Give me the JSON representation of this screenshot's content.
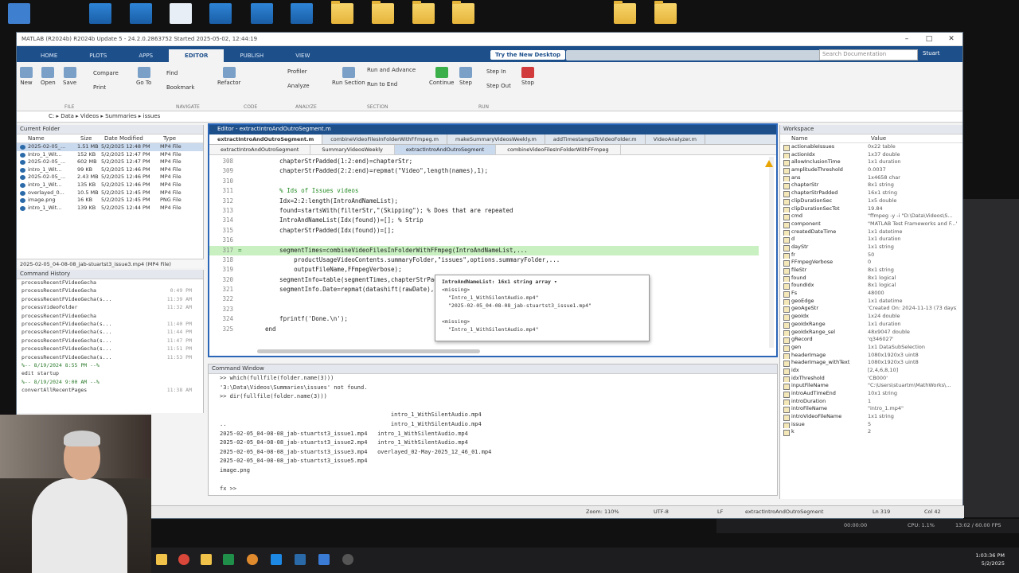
{
  "window": {
    "title": "MATLAB (R2024b) R2024b Update 5 - 24.2.0.2863752 Started 2025-05-02, 12:44:19"
  },
  "ribbon_tabs": [
    "HOME",
    "PLOTS",
    "APPS",
    "EDITOR",
    "PUBLISH",
    "VIEW"
  ],
  "active_tab": "EDITOR",
  "try_new_desktop": "Try the New Desktop",
  "search_placeholder": "Search Documentation",
  "user_name": "Stuart",
  "ribbon": {
    "buttons": [
      "New",
      "Open",
      "Save",
      "Compare",
      "Print",
      "Go To",
      "Find",
      "Bookmark",
      "Refactor",
      "Profiler",
      "Analyze",
      "Run Section",
      "Run and Advance",
      "Run to End",
      "Continue",
      "Step",
      "Step In",
      "Step Out",
      "Stop"
    ],
    "sections": [
      "FILE",
      "NAVIGATE",
      "CODE",
      "ANALYZE",
      "SECTION",
      "RUN"
    ]
  },
  "address_path": "C:  ▸  Data  ▸  Videos  ▸  Summaries  ▸  issues",
  "current_folder": {
    "title": "Current Folder",
    "columns": [
      "Name",
      "Size",
      "Date Modified",
      "Type"
    ],
    "files": [
      {
        "name": "2025-02-05_...",
        "size": "1.51 MB",
        "date": "5/2/2025 12:48 PM",
        "type": "MP4 File"
      },
      {
        "name": "Intro_1_Wit...",
        "size": "152 KB",
        "date": "5/2/2025 12:47 PM",
        "type": "MP4 File"
      },
      {
        "name": "2025-02-05_...",
        "size": "602 MB",
        "date": "5/2/2025 12:47 PM",
        "type": "MP4 File"
      },
      {
        "name": "intro_1_Wit...",
        "size": "99 KB",
        "date": "5/2/2025 12:46 PM",
        "type": "MP4 File"
      },
      {
        "name": "2025-02-05_...",
        "size": "2.43 MB",
        "date": "5/2/2025 12:46 PM",
        "type": "MP4 File"
      },
      {
        "name": "intro_1_Wit...",
        "size": "135 KB",
        "date": "5/2/2025 12:46 PM",
        "type": "MP4 File"
      },
      {
        "name": "overlayed_0...",
        "size": "10.5 MB",
        "date": "5/2/2025 12:45 PM",
        "type": "MP4 File"
      },
      {
        "name": "image.png",
        "size": "16 KB",
        "date": "5/2/2025 12:45 PM",
        "type": "PNG File"
      },
      {
        "name": "intro_1_Wit...",
        "size": "139 KB",
        "date": "5/2/2025 12:44 PM",
        "type": "MP4 File"
      }
    ],
    "detail": "2025-02-05_04-08-08_jab-stuartst3_issue3.mp4 (MP4 File)"
  },
  "command_history": {
    "title": "Command History",
    "rows": [
      {
        "text": "processRecentFVideoGecha",
        "time": ""
      },
      {
        "text": "processRecentFVideoGecha",
        "time": "0:49 PM"
      },
      {
        "text": "processRecentFVideoGecha(s...",
        "time": "11:39 AM"
      },
      {
        "text": "processVideoFolder",
        "time": "11:32 AM"
      },
      {
        "text": "processRecentFVideoGecha",
        "time": ""
      },
      {
        "text": "processRecentFVideoGecha(s...",
        "time": "11:40 PM"
      },
      {
        "text": "processRecentFVideoGecha(s...",
        "time": "11:44 PM"
      },
      {
        "text": "processRecentFVideoGecha(s...",
        "time": "11:47 PM"
      },
      {
        "text": "processRecentFVideoGecha(s...",
        "time": "11:51 PM"
      },
      {
        "text": "processRecentFVideoGecha(s...",
        "time": "11:53 PM"
      },
      {
        "text": "%-- 8/19/2024 8:55 PM --%",
        "time": "",
        "sep": true
      },
      {
        "text": "edit startup",
        "time": ""
      },
      {
        "text": "%-- 8/19/2024 9:00 AM --%",
        "time": "",
        "sep": true
      },
      {
        "text": "convertAllRecentPages",
        "time": "11:38 AM"
      }
    ]
  },
  "editor": {
    "title": "Editor - extractIntroAndOutroSegment.m",
    "file_tabs": [
      "extractIntroAndOutroSegment.m",
      "combineVideoFilesInFolderWithFFmpeg.m",
      "makeSummaryVideosWeekly.m",
      "addTimestampsToVideoFolder.m",
      "VideoAnalyzer.m"
    ],
    "func_tabs": [
      "extractIntroAndOutroSegment",
      "SummaryVideosWeekly",
      "extractIntroAndOutroSegment",
      "combineVideoFilesInFolderWithFFmpeg"
    ],
    "active_func_tab": 2,
    "lines": [
      {
        "n": "308",
        "text": "    chapterStrPadded(1:2:end)=chapterStr;"
      },
      {
        "n": "309",
        "text": "    chapterStrPadded(2:2:end)=repmat(\"Video\",length(names),1);"
      },
      {
        "n": "310",
        "text": ""
      },
      {
        "n": "311",
        "text": "    % Ids of Issues videos"
      },
      {
        "n": "312",
        "text": "    Idx=2:2:length(IntroAndNameList);"
      },
      {
        "n": "313",
        "text": "    found=startsWith(filterStr,\"(Skipping\"); % Does that are repeated"
      },
      {
        "n": "314",
        "text": "    IntroAndNameList(Idx(found))=[]; % Strip"
      },
      {
        "n": "315",
        "text": "    chapterStrPadded(Idx(found))=[];"
      },
      {
        "n": "316",
        "text": ""
      },
      {
        "n": "317",
        "text": "    segmentTimes=combineVideoFilesInFolderWithFFmpeg(IntroAndNameList,...",
        "hl": true,
        "marker": "="
      },
      {
        "n": "318",
        "text": "        productUsageVideoContents.summaryFolder,\"issues\",options.summaryFolder,..."
      },
      {
        "n": "319",
        "text": "        outputFileName,FFmpegVerbose);"
      },
      {
        "n": "320",
        "text": "    segmentInfo=table(segmentTimes,chapterStrPadded,..."
      },
      {
        "n": "321",
        "text": "    segmentInfo.Date=repmat(datashift(rawDate),..."
      },
      {
        "n": "322",
        "text": ""
      },
      {
        "n": "323",
        "text": ""
      },
      {
        "n": "324",
        "text": "    fprintf('Done.\\n');"
      },
      {
        "n": "325",
        "text": "end"
      }
    ],
    "tooltip": {
      "header": "IntroAndNameList: 16x1 string array ▾",
      "lines": [
        "<missing>",
        "\"Intro_1_WithSilentAudio.mp4\"",
        "\"2025-02-05_04-08-08_jab-stuartst3_issue1.mp4\"",
        "",
        "<missing>",
        "\"Intro_1_WithSilentAudio.mp4\""
      ]
    }
  },
  "command_window": {
    "title": "Command Window",
    "lines": [
      ">> which(fullfile(folder.name(3)))",
      "'3:\\Data\\Videos\\Summaries\\issues' not found.",
      ">> dir(fullfile(folder.name(3)))",
      "",
      "                                                   intro_1_WithSilentAudio.mp4",
      "..                                                 intro_1_WithSilentAudio.mp4",
      "2025-02-05_04-08-08_jab-stuartst3_issue1.mp4   intro_1_WithSilentAudio.mp4",
      "2025-02-05_04-08-08_jab-stuartst3_issue2.mp4   intro_1_WithSilentAudio.mp4",
      "2025-02-05_04-08-08_jab-stuartst3_issue3.mp4   overlayed_02-May-2025_12_46_01.mp4",
      "2025-02-05_04-08-08_jab-stuartst3_issue5.mp4",
      "image.png",
      "",
      "fx >>"
    ]
  },
  "workspace": {
    "title": "Workspace",
    "columns": [
      "Name",
      "Value"
    ],
    "vars": [
      [
        "actionableIssues",
        "0x22 table"
      ],
      [
        "actionIdx",
        "1x37 double"
      ],
      [
        "allowInclusionTime",
        "1x1 duration"
      ],
      [
        "amplitudeThreshold",
        "0.0037"
      ],
      [
        "ans",
        "1x4658 char"
      ],
      [
        "chapterStr",
        "8x1 string"
      ],
      [
        "chapterStrPadded",
        "16x1 string"
      ],
      [
        "clipDurationSec",
        "1x5 double"
      ],
      [
        "clipDurationSecTot",
        "19.84"
      ],
      [
        "cmd",
        "\"ffmpeg -y -i \"D:\\Data\\Videos\\S..."
      ],
      [
        "component",
        "\"MATLAB Test Frameworks and F...\""
      ],
      [
        "createdDateTime",
        "1x1 datetime"
      ],
      [
        "d",
        "1x1 duration"
      ],
      [
        "dayStr",
        "1x1 string"
      ],
      [
        "fr",
        "50"
      ],
      [
        "FFmpegVerbose",
        "0"
      ],
      [
        "fileStr",
        "8x1 string"
      ],
      [
        "found",
        "8x1 logical"
      ],
      [
        "foundIdx",
        "8x1 logical"
      ],
      [
        "Fs",
        "48000"
      ],
      [
        "geoEdge",
        "1x1 datetime"
      ],
      [
        "geoAgeStr",
        "'Created On: 2024-11-13 (73 days)'"
      ],
      [
        "geoIdx",
        "1x24 double"
      ],
      [
        "geoIdxRange",
        "1x1 duration"
      ],
      [
        "geoIdxRange_sel",
        "48x9047 double"
      ],
      [
        "gRecord",
        "'q346027'"
      ],
      [
        "gen",
        "1x1 DataSubSelection"
      ],
      [
        "headerImage",
        "1080x1920x3 uint8"
      ],
      [
        "headerImage_withText",
        "1080x1920x3 uint8"
      ],
      [
        "idx",
        "[2,4,6,8,10]"
      ],
      [
        "idxThreshold",
        "'CB000'"
      ],
      [
        "inputFileName",
        "\"C:\\Users\\stuartm\\MathWorks\\..."
      ],
      [
        "introAudTimeEnd",
        "10x1 string"
      ],
      [
        "introDuration",
        "1"
      ],
      [
        "introFileName",
        "\"intro_1.mp4\""
      ],
      [
        "introVideoFileName",
        "1x1 string"
      ],
      [
        "issue",
        "5"
      ],
      [
        "k",
        "2"
      ]
    ]
  },
  "status_bar": {
    "zoom": "Zoom: 110%",
    "encoding": "UTF-8",
    "eol": "LF",
    "script": "extractIntroAndOutroSegment",
    "line": "Ln 319",
    "col": "Col 42"
  },
  "obs_bar": {
    "time": "00:00:00",
    "cpu": "CPU: 1.1%",
    "fps": "13:02 / 60.00 FPS"
  },
  "taskbar_clock": {
    "time": "1:03:36 PM",
    "date": "5/2/2025"
  },
  "colors": {
    "ribbon_blue": "#1d4f8b",
    "highlight_line": "#c8f0c0",
    "string_purple": "#a020f0",
    "comment_green": "#228b22"
  }
}
